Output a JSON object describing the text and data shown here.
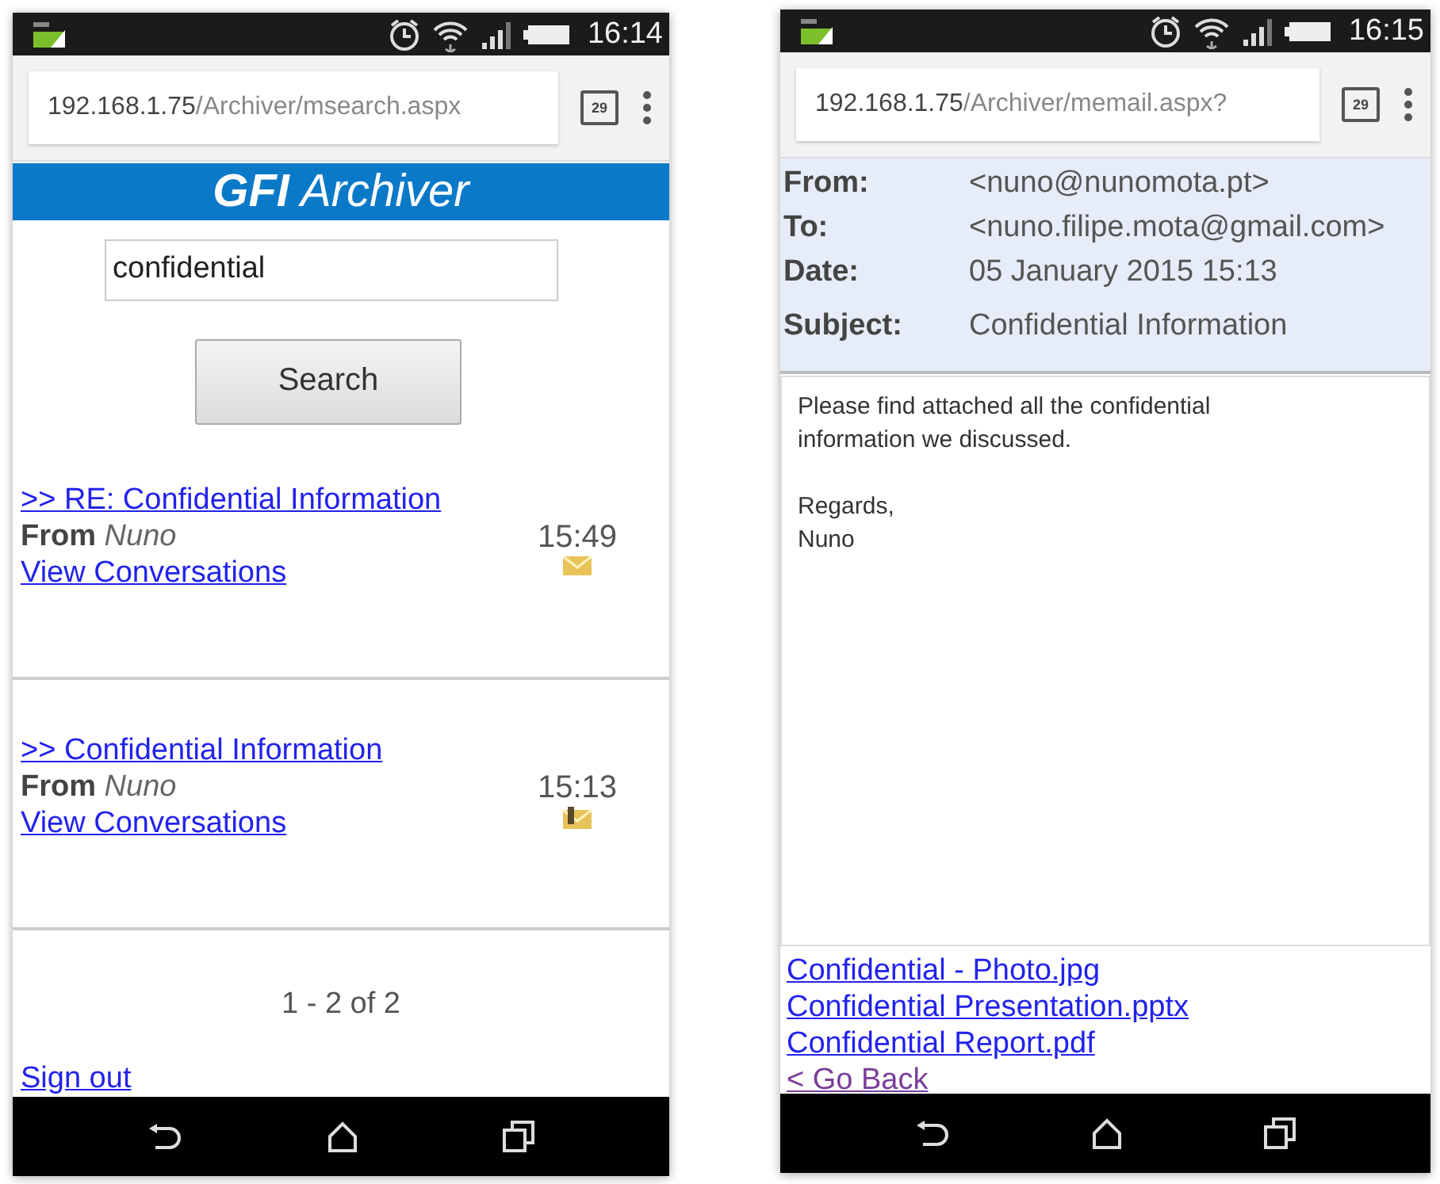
{
  "search_screen": {
    "status_bar": {
      "time": "16:14"
    },
    "browser": {
      "url": "**192.168.1.75**/Archiver/msearch.aspx",
      "tab_count": "29"
    },
    "banner": {
      "logo": "**GFI** Archiver"
    },
    "search": {
      "value": "confidential",
      "button": "Search"
    },
    "results": [
      {
        "subject": ">> RE: Confidential Information",
        "from": "**From** *Nuno*",
        "link": "View Conversations",
        "time": "15:49",
        "kind": "plain"
      },
      {
        "subject": ">> Confidential Information",
        "from": "**From** *Nuno*",
        "link": "View Conversations",
        "time": "15:13",
        "kind": "attachment"
      }
    ],
    "pagination": "1 - 2 of 2",
    "sign_out": "Sign out"
  },
  "email_screen": {
    "status_bar": {
      "time": "16:15"
    },
    "browser": {
      "url": "**192.168.1.75**/Archiver/memail.aspx?",
      "tab_count": "29"
    },
    "headers": [
      {
        "label": "From:",
        "value": "<nuno@nunomota.pt>"
      },
      {
        "label": "To:",
        "value": "<nuno.filipe.mota@gmail.com>"
      },
      {
        "label": "Date:",
        "value": "05 January 2015 15:13"
      },
      {
        "label": "Subject:",
        "value": "Confidential Information"
      }
    ],
    "body": [
      "Please find attached all the confidential information we discussed.",
      "Regards,\nNuno"
    ],
    "attachments": [
      "Confidential - Photo.jpg",
      "Confidential Presentation.pptx",
      "Confidential Report.pdf"
    ],
    "go_back": "< Go Back"
  }
}
